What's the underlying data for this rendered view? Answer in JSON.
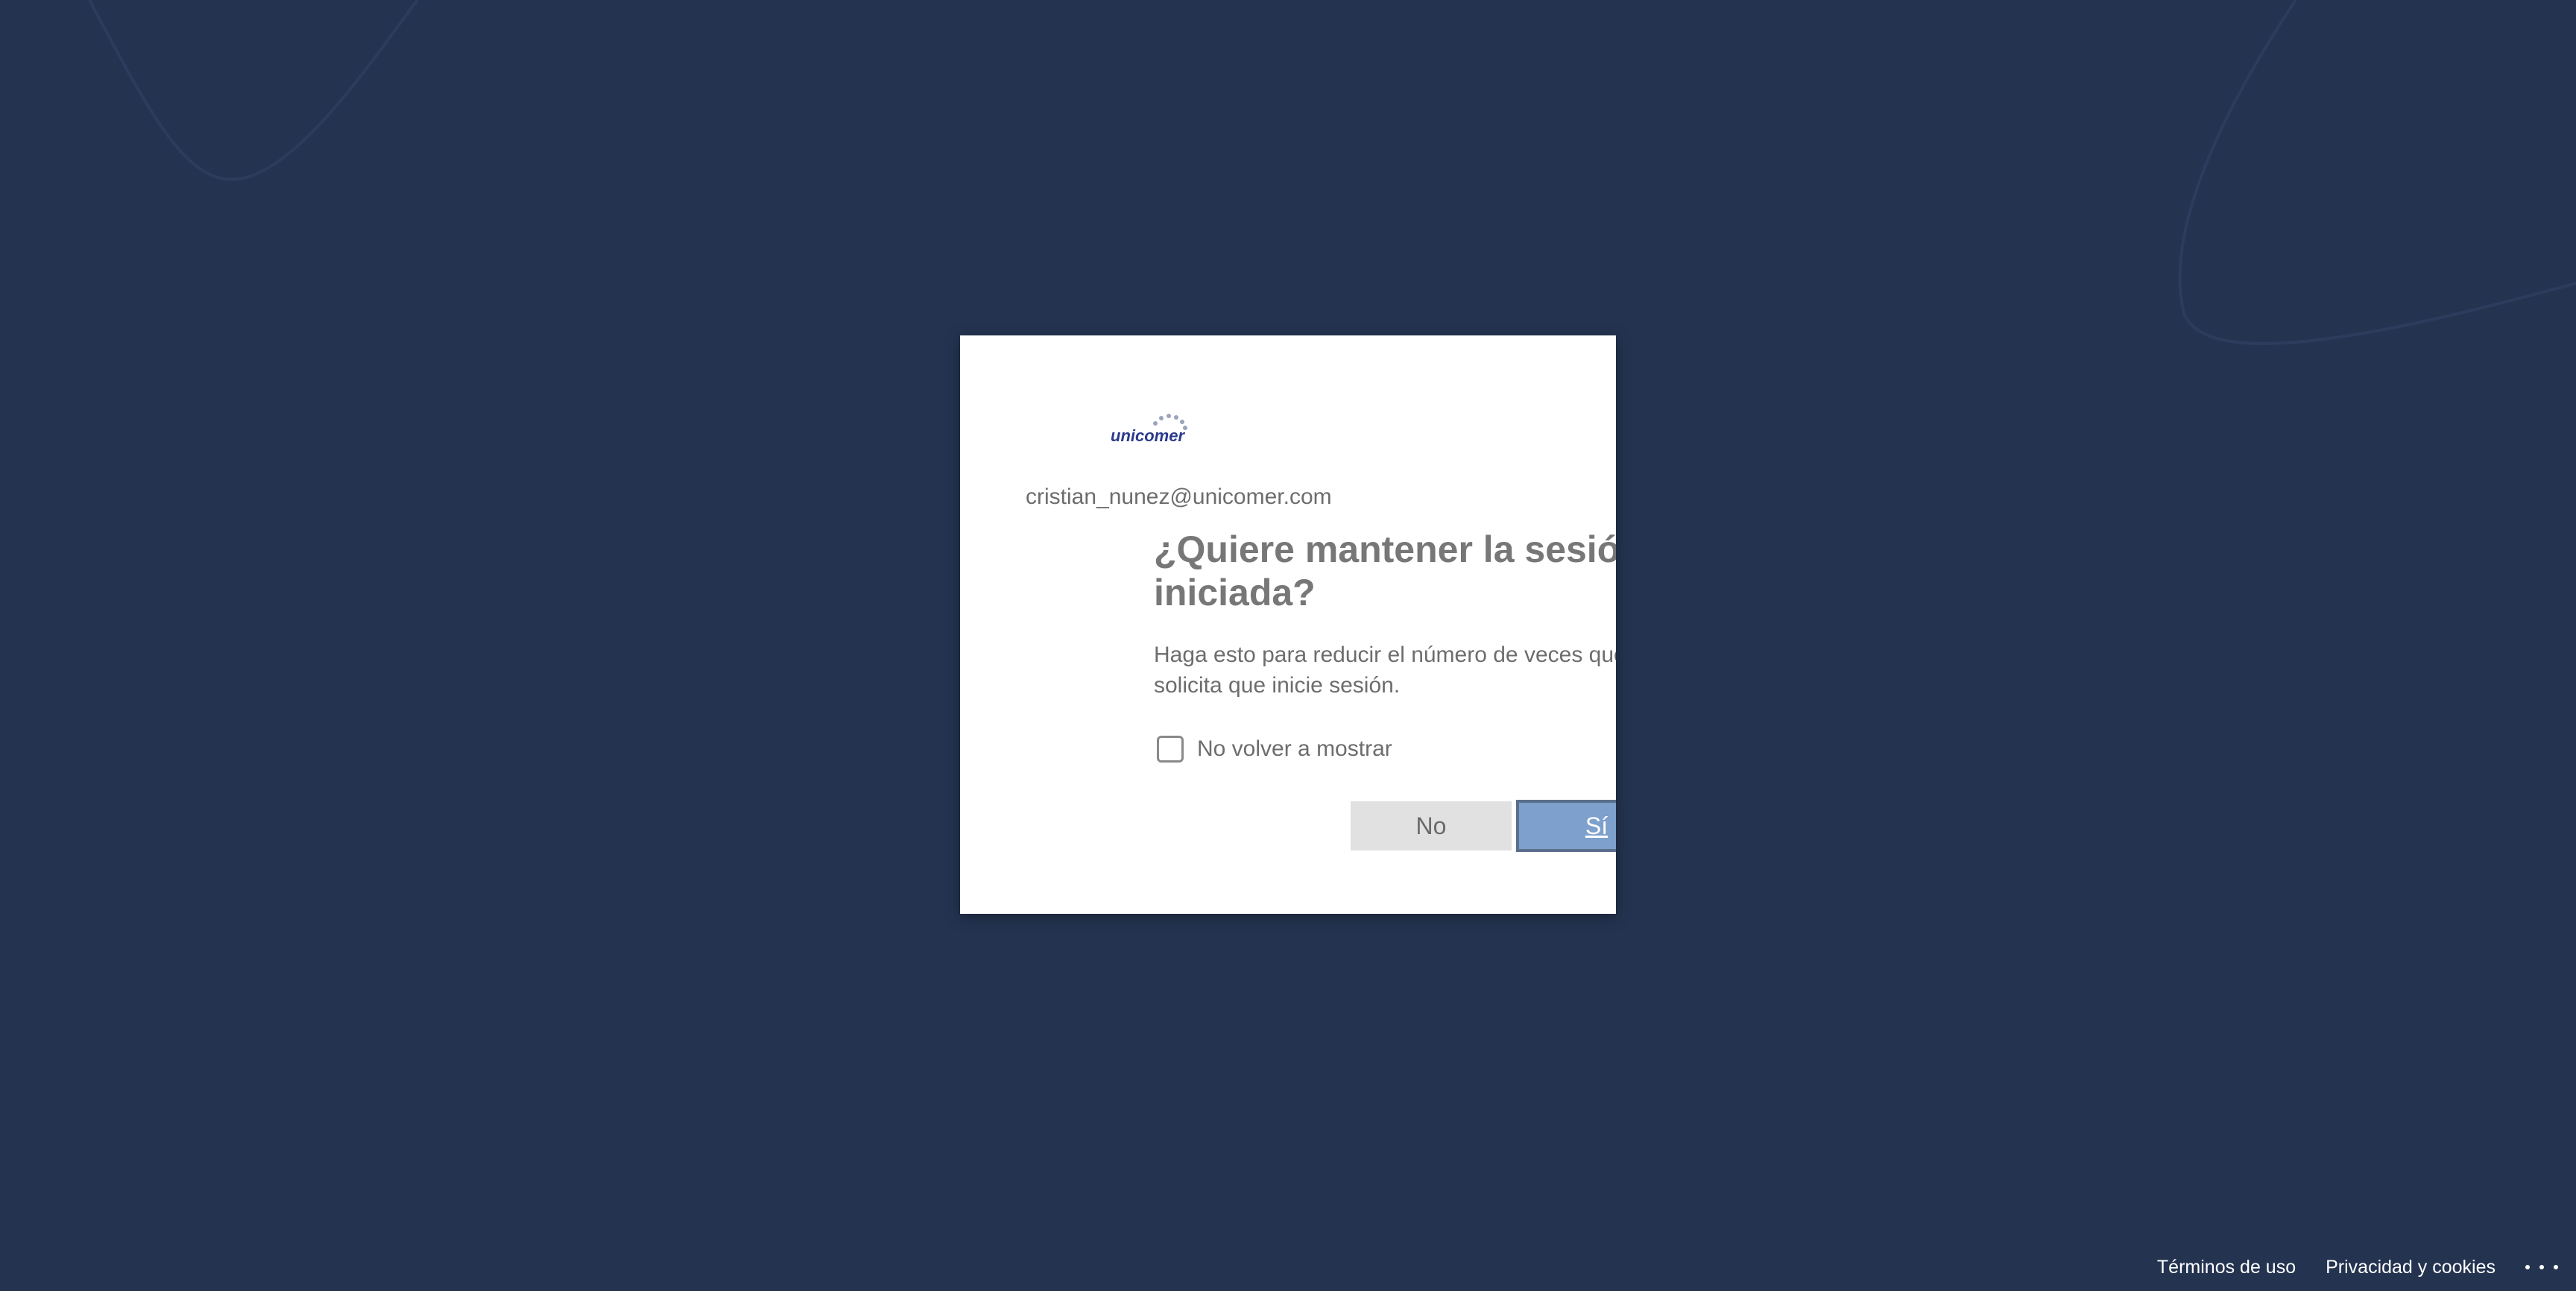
{
  "dialog": {
    "logo_text": "unicomer",
    "email": "cristian_nunez@unicomer.com",
    "heading": "¿Quiere mantener la sesión iniciada?",
    "description": "Haga esto para reducir el número de veces que le solicita que inicie sesión.",
    "checkbox_label": "No volver a mostrar",
    "checkbox_checked": false,
    "no_label": "No",
    "yes_label": "Sí"
  },
  "footer": {
    "terms": "Términos de uso",
    "privacy": "Privacidad y cookies",
    "more_icon": "ellipsis-icon"
  },
  "colors": {
    "background": "#243350",
    "primary_button": "#7da0cc",
    "secondary_button": "#e1e1e1",
    "logo": "#2b3a8c"
  }
}
